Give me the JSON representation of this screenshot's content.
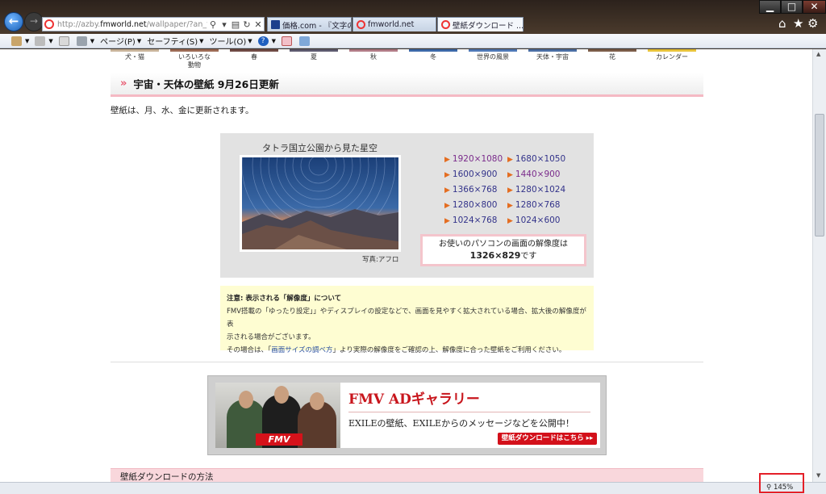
{
  "browser": {
    "url_host_prefix": "http://azby.",
    "url_host": "fmworld.net",
    "url_path": "/wallpaper/?an_top=dnk",
    "tabs": [
      {
        "label": "価格.com - 『文字の..."
      },
      {
        "label": "fmworld.net"
      },
      {
        "label": "壁紙ダウンロード ..."
      }
    ],
    "commands": {
      "page": "ページ(P)",
      "safety": "セーフティ(S)",
      "tools": "ツール(O)"
    },
    "zoom": "145%"
  },
  "categories": [
    "犬・猫",
    "いろいろな\n動物",
    "春",
    "夏",
    "秋",
    "冬",
    "世界の風景",
    "天体・宇宙",
    "花",
    "カレンダー"
  ],
  "section": {
    "title": "宇宙・天体の壁紙 9月26日更新",
    "update_note": "壁紙は、月、水、金に更新されます。"
  },
  "wallpaper": {
    "title": "タトラ国立公園から見た星空",
    "credit": "写真:アフロ",
    "resolutions_left": [
      "1920×1080",
      "1600×900",
      "1366×768",
      "1280×800",
      "1024×768"
    ],
    "resolutions_right": [
      "1680×1050",
      "1440×900",
      "1280×1024",
      "1280×768",
      "1024×600"
    ],
    "your_resolution_label": "お使いのパソコンの画面の解像度は",
    "your_resolution_value": "1326×829",
    "your_resolution_suffix": "です"
  },
  "caution": {
    "heading": "注意: 表示される「解像度」について",
    "line1": "FMV搭載の「ゆったり設定」」やディスプレイの設定などで、画面を見やすく拡大されている場合、拡大後の解像度が表",
    "line2": "示される場合がございます。",
    "line3_pre": "その場合は、「",
    "line3_link": "画面サイズの調べ方",
    "line3_post": "」より実際の解像度をご確認の上、解像度に合った壁紙をご利用ください。"
  },
  "ad": {
    "logo": "FMV",
    "title": "FMV ADギャラリー",
    "body": "EXILEの壁紙、EXILEからのメッセージなどを公開中！",
    "button": "壁紙ダウンロードはこちら ▸▸"
  },
  "howto": {
    "title": "壁紙ダウンロードの方法"
  },
  "colors": {
    "accent_pink": "#f5b9c3",
    "link_blue": "#33338a",
    "arrow_orange": "#e46d21",
    "ad_red": "#d3101a"
  }
}
